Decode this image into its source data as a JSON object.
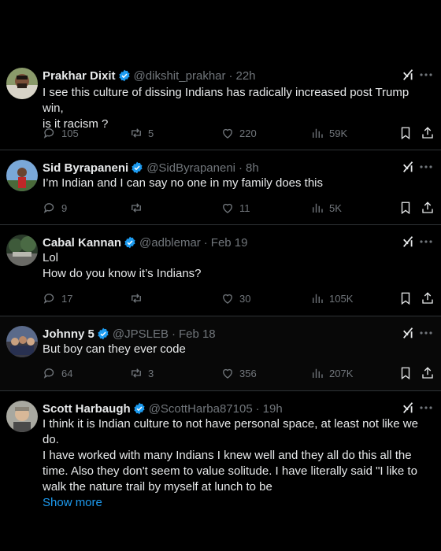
{
  "tweets": [
    {
      "name": "Prakhar Dixit",
      "handle": "@dikshit_prakhar",
      "time": "22h",
      "lines": [
        "I see this culture of dissing Indians has radically increased post Trump win,",
        "is it racism ?"
      ],
      "replies": "105",
      "reposts": "5",
      "likes": "220",
      "views": "59K"
    },
    {
      "name": "Sid Byrapaneni",
      "handle": "@SidByrapaneni",
      "time": "8h",
      "lines": [
        "I’m Indian and I can say no one in my family does this"
      ],
      "replies": "9",
      "reposts": "",
      "likes": "11",
      "views": "5K"
    },
    {
      "name": "Cabal Kannan",
      "handle": "@adblemar",
      "time": "Feb 19",
      "lines": [
        "Lol",
        "How do you know it’s Indians?"
      ],
      "replies": "17",
      "reposts": "",
      "likes": "30",
      "views": "105K"
    },
    {
      "name": "Johnny 5",
      "handle": "@JPSLEB",
      "time": "Feb 18",
      "lines": [
        "But boy can they ever code"
      ],
      "replies": "64",
      "reposts": "3",
      "likes": "356",
      "views": "207K"
    },
    {
      "name": "Scott Harbaugh",
      "handle": "@ScottHarba87105",
      "time": "19h",
      "lines": [
        "I think it is Indian culture to not have personal space, at least not like we do.",
        "I have worked with many Indians I knew well and they all do this all the",
        "time. Also they don't seem to value solitude. I have literally said \"I like to",
        "walk the nature trail by myself at lunch to be"
      ],
      "show_more": "Show more"
    }
  ],
  "separator": "·",
  "colors": {
    "verified": "#1d9bf0",
    "muted": "#71767b",
    "link": "#1d9bf0",
    "text": "#e7e9ea"
  }
}
